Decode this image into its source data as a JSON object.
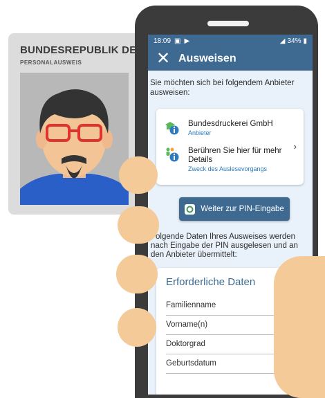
{
  "id_card": {
    "country": "BUNDESREPUBLIK DEUTS",
    "document_type": "PERSONALAUSWEIS"
  },
  "status_bar": {
    "time": "18:09",
    "battery": "34%"
  },
  "app_bar": {
    "close_icon": "close-icon",
    "title": "Ausweisen"
  },
  "intro_text": "Sie möchten sich bei folgendem Anbieter ausweisen:",
  "provider": {
    "name": "Bundesdruckerei GmbH",
    "role": "Anbieter",
    "details_text": "Berühren Sie hier für mehr Details",
    "details_link": "Zweck des Auslesevorgangs"
  },
  "pin_button": "Weiter zur PIN-Eingabe",
  "data_note": "Folgende Daten Ihres Ausweises werden nach Eingabe der PIN ausgelesen und an den Anbieter übermittelt:",
  "required_data": {
    "title": "Erforderliche Daten",
    "fields": [
      "Familienname",
      "Vorname(n)",
      "Doktorgrad",
      "Geburtsdatum"
    ]
  },
  "colors": {
    "app_blue": "#3e6a92",
    "screen_bg": "#e9f1fa",
    "skin": "#f3ca98",
    "phone_body": "#3b3b3b"
  }
}
